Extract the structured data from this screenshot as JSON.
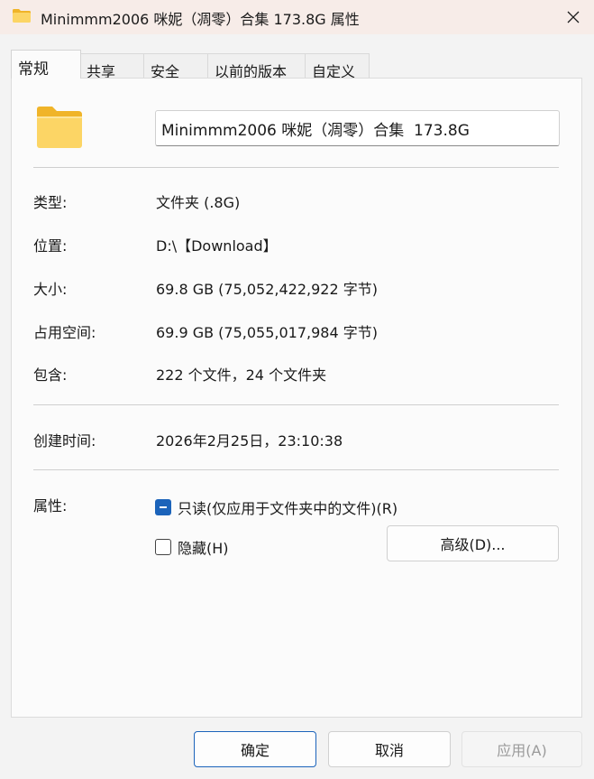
{
  "window": {
    "title": "Minimmm2006 咪妮（凋零）合集 173.8G 属性"
  },
  "tabs": [
    {
      "label": "常规"
    },
    {
      "label": "共享"
    },
    {
      "label": "安全"
    },
    {
      "label": "以前的版本"
    },
    {
      "label": "自定义"
    }
  ],
  "general": {
    "name_value": "Minimmm2006 咪妮（凋零）合集  173.8G",
    "type_label": "类型:",
    "type_value": "文件夹 (.8G)",
    "location_label": "位置:",
    "location_value": "D:\\【Download】",
    "size_label": "大小:",
    "size_value": "69.8 GB (75,052,422,922 字节)",
    "size_on_disk_label": "占用空间:",
    "size_on_disk_value": "69.9 GB (75,055,017,984 字节)",
    "contains_label": "包含:",
    "contains_value": "222 个文件，24 个文件夹",
    "created_label": "创建时间:",
    "created_value": "2026年2月25日，23:10:38",
    "attributes_label": "属性:",
    "readonly_label": "只读(仅应用于文件夹中的文件)(R)",
    "hidden_label": "隐藏(H)",
    "advanced_button": "高级(D)..."
  },
  "footer": {
    "ok": "确定",
    "cancel": "取消",
    "apply": "应用(A)"
  },
  "colors": {
    "accent": "#1b63ba",
    "folder_body": "#fcd565",
    "folder_back": "#f0b429"
  },
  "icons": [
    "folder-icon",
    "close-icon",
    "large-folder-icon"
  ]
}
